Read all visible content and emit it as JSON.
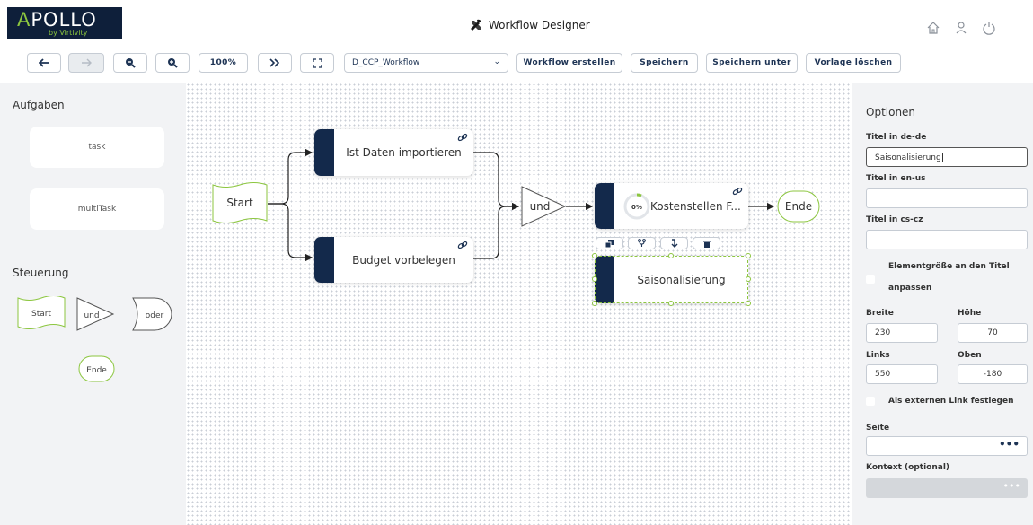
{
  "header": {
    "logo_text": "APOLLO",
    "logo_sub": "by Virtivity",
    "title": "Workflow Designer",
    "icons": [
      "wrench-ruler-icon",
      "home-icon",
      "user-icon",
      "power-icon"
    ]
  },
  "toolbar": {
    "zoom_label": "100%",
    "workflow_select": "D_CCP_Workflow",
    "create_label": "Workflow erstellen",
    "save_label": "Speichern",
    "save_as_label": "Speichern unter",
    "delete_template_label": "Vorlage löschen"
  },
  "left_panel": {
    "tasks_heading": "Aufgaben",
    "tasks": [
      "task",
      "multiTask"
    ],
    "control_heading": "Steuerung",
    "control_items": [
      "Start",
      "und",
      "oder",
      "Ende"
    ]
  },
  "canvas": {
    "nodes": {
      "start": "Start",
      "import": "Ist Daten importieren",
      "budget": "Budget vorbelegen",
      "and": "und",
      "kosten": "Kostenstellen F...",
      "kosten_progress": "0%",
      "end": "Ende",
      "saison": "Saisonalisierung"
    }
  },
  "right_panel": {
    "title": "Optionen",
    "title_de_label": "Titel in de-de",
    "title_de_value": "Saisonalisierung",
    "title_en_label": "Titel in en-us",
    "title_en_value": "",
    "title_cs_label": "Titel in cs-cz",
    "title_cs_value": "",
    "fit_size_label_1": "Elementgröße an den Titel",
    "fit_size_label_2": "anpassen",
    "width_label": "Breite",
    "width_value": "230",
    "height_label": "Höhe",
    "height_value": "70",
    "left_label": "Links",
    "left_value": "550",
    "top_label": "Oben",
    "top_value": "-180",
    "external_link_label": "Als externen Link festlegen",
    "page_label": "Seite",
    "page_value": "",
    "context_label": "Kontext (optional)",
    "dots": "•••"
  },
  "colors": {
    "navy": "#13294b",
    "accent_green": "#8cc63f",
    "panel_bg": "#f2f3f5"
  }
}
